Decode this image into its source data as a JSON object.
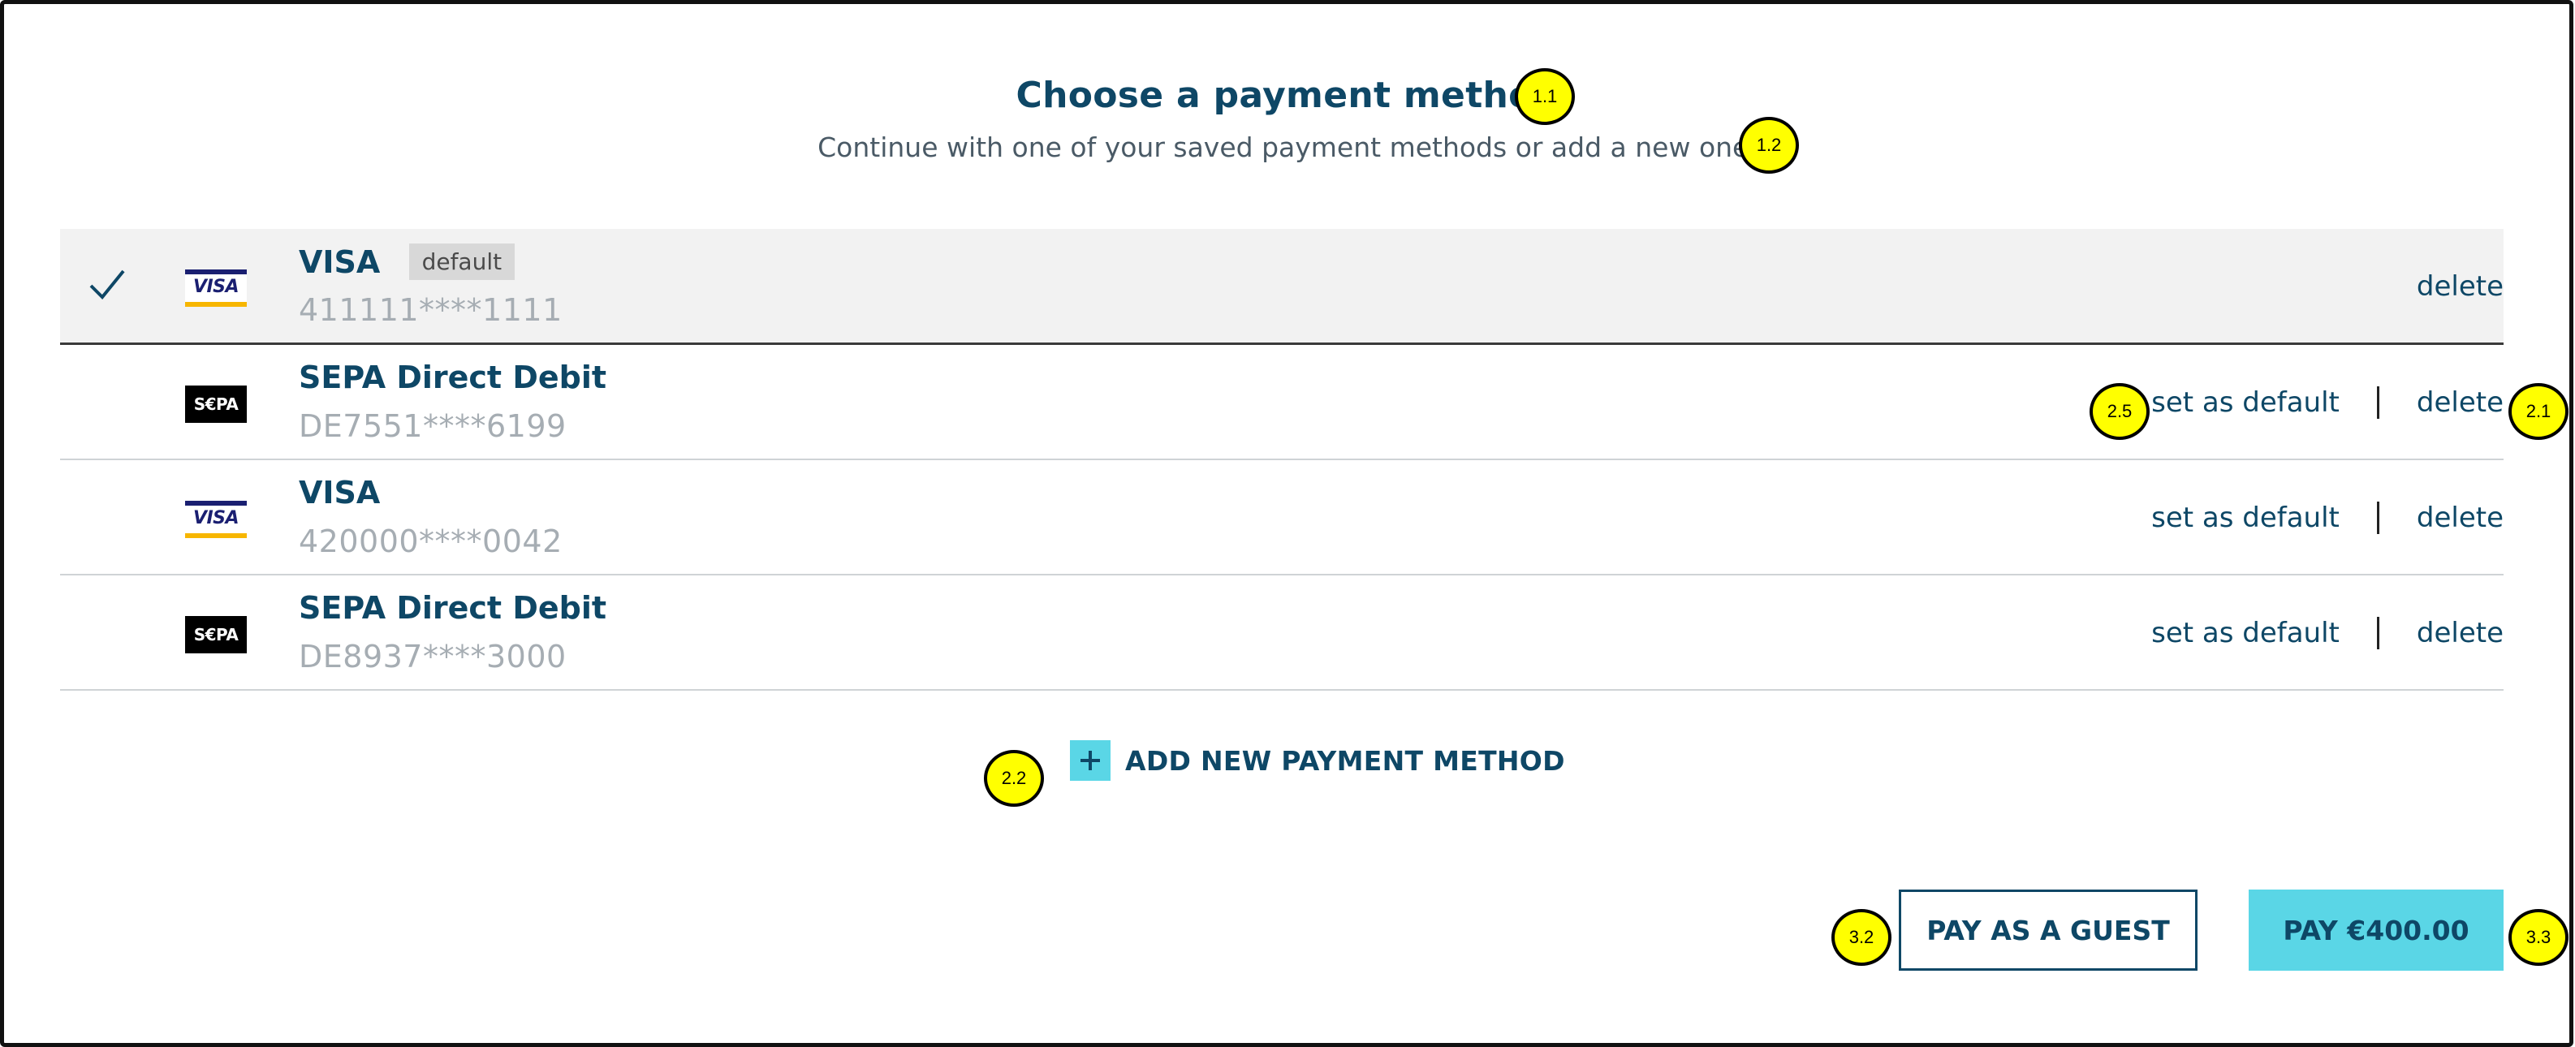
{
  "header": {
    "title": "Choose a payment method",
    "subtitle": "Continue with one of your saved payment methods or add a new one."
  },
  "payment_methods": [
    {
      "type": "VISA",
      "logo": "VISA",
      "number": "411111****1111",
      "default_badge": "default",
      "selected": true,
      "delete_label": "delete"
    },
    {
      "type": "SEPA Direct Debit",
      "logo": "S€PA",
      "number": "DE7551****6199",
      "set_default_label": "set as default",
      "delete_label": "delete"
    },
    {
      "type": "VISA",
      "logo": "VISA",
      "number": "420000****0042",
      "set_default_label": "set as default",
      "delete_label": "delete"
    },
    {
      "type": "SEPA Direct Debit",
      "logo": "S€PA",
      "number": "DE8937****3000",
      "set_default_label": "set as default",
      "delete_label": "delete"
    }
  ],
  "add_new": {
    "label": "ADD NEW PAYMENT METHOD",
    "icon": "plus-icon"
  },
  "buttons": {
    "guest": "PAY AS A GUEST",
    "pay": "PAY €400.00"
  },
  "markers": [
    "1.1",
    "1.2",
    "2.5",
    "2.1",
    "2.2",
    "3.2",
    "3.3"
  ],
  "colors": {
    "primary_text": "#0e4766",
    "accent": "#5ad6e6",
    "marker": "#ffff00",
    "muted": "#a6adb3"
  }
}
